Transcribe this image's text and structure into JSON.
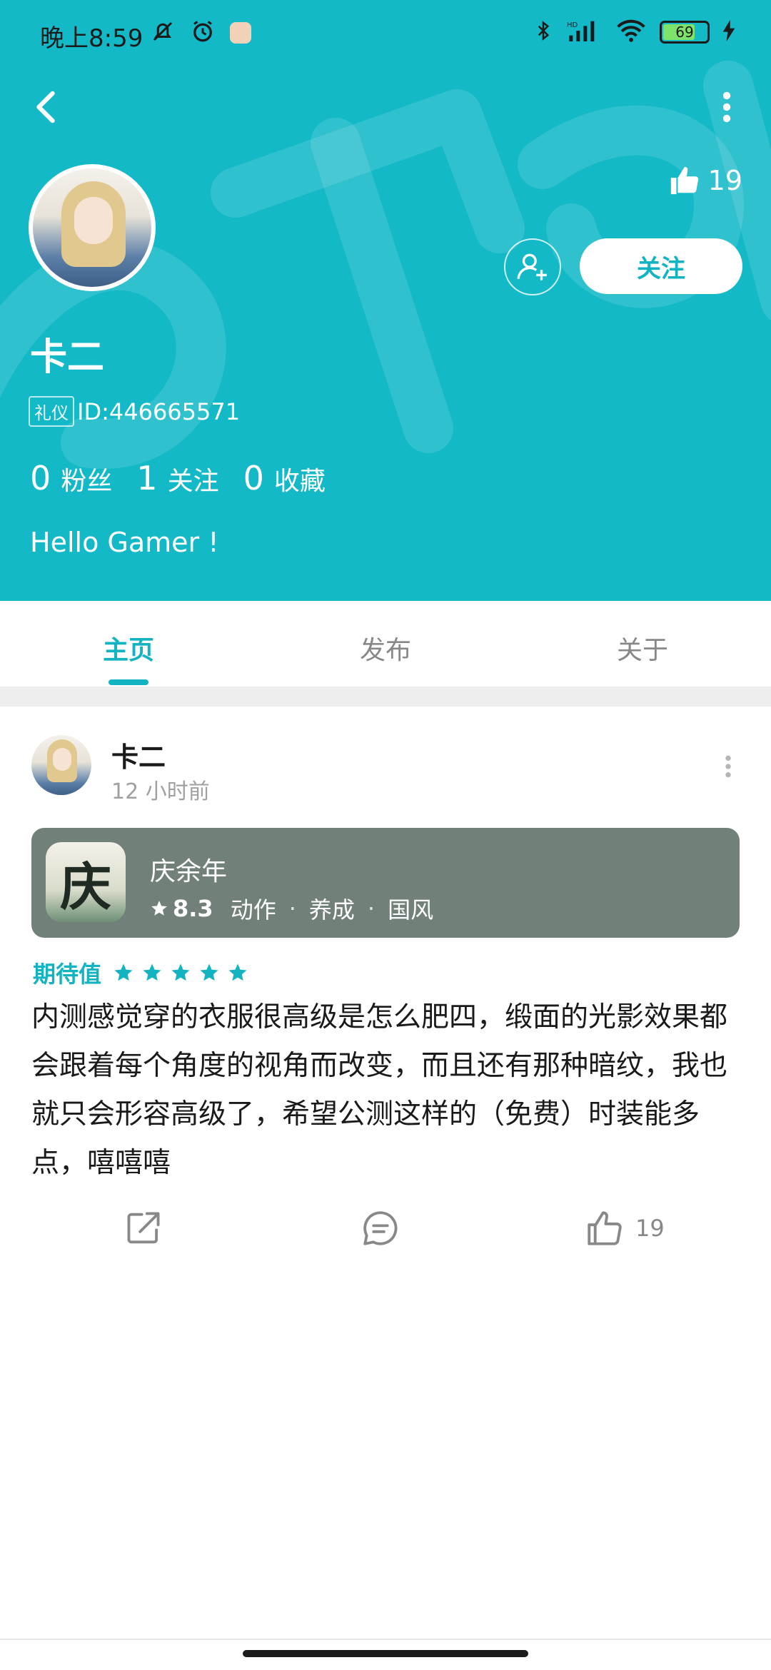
{
  "status_bar": {
    "time": "晚上8:59",
    "battery": "69",
    "icons": [
      "mute-icon",
      "alarm-icon",
      "app-icon",
      "bluetooth-icon",
      "signal-icon",
      "wifi-icon",
      "battery-icon",
      "charging-icon"
    ]
  },
  "colors": {
    "accent": "#14b9c8",
    "card": "#718078"
  },
  "profile": {
    "likes": "19",
    "follow_label": "关注",
    "name": "卡二",
    "badge": "礼仪",
    "id_text": "ID:446665571",
    "stats": [
      {
        "num": "0",
        "label": "粉丝"
      },
      {
        "num": "1",
        "label": "关注"
      },
      {
        "num": "0",
        "label": "收藏"
      }
    ],
    "bio": "Hello Gamer !"
  },
  "tabs": [
    {
      "label": "主页",
      "active": true
    },
    {
      "label": "发布",
      "active": false
    },
    {
      "label": "关于",
      "active": false
    }
  ],
  "post": {
    "author": "卡二",
    "time": "12 小时前",
    "game": {
      "name": "庆余年",
      "score": "8.3",
      "tags": [
        "动作",
        "养成",
        "国风"
      ],
      "icon_glyph": "庆"
    },
    "rating_label": "期待值",
    "rating_stars": 5,
    "text": "内测感觉穿的衣服很高级是怎么肥四，缎面的光影效果都会跟着每个角度的视角而改变，而且还有那种暗纹，我也就只会形容高级了，希望公测这样的（免费）时装能多点，嘻嘻嘻",
    "like_count": "19"
  }
}
